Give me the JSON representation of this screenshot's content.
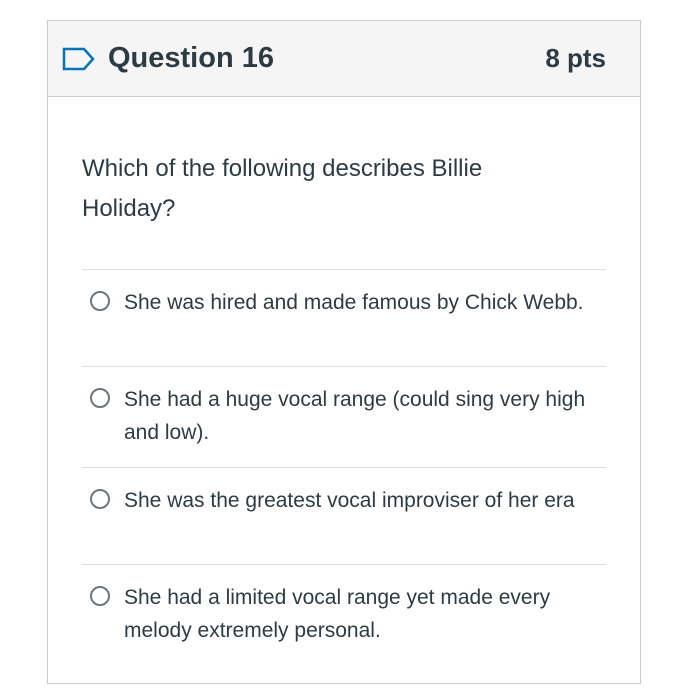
{
  "question": {
    "title": "Question 16",
    "points": "8 pts",
    "flag_icon": "flag-icon",
    "text": "Which of the following describes Billie Holiday?",
    "answers": [
      {
        "label": "She was hired and made famous by Chick Webb."
      },
      {
        "label": "She had a huge vocal range (could sing very high and low)."
      },
      {
        "label": "She was the greatest vocal improviser of her era"
      },
      {
        "label": "She had a limited vocal range yet made every melody extremely personal."
      }
    ]
  },
  "colors": {
    "text": "#2d3b45",
    "header_bg": "#f5f5f5",
    "border": "#c7cdd1",
    "flag": "#0374b5"
  }
}
